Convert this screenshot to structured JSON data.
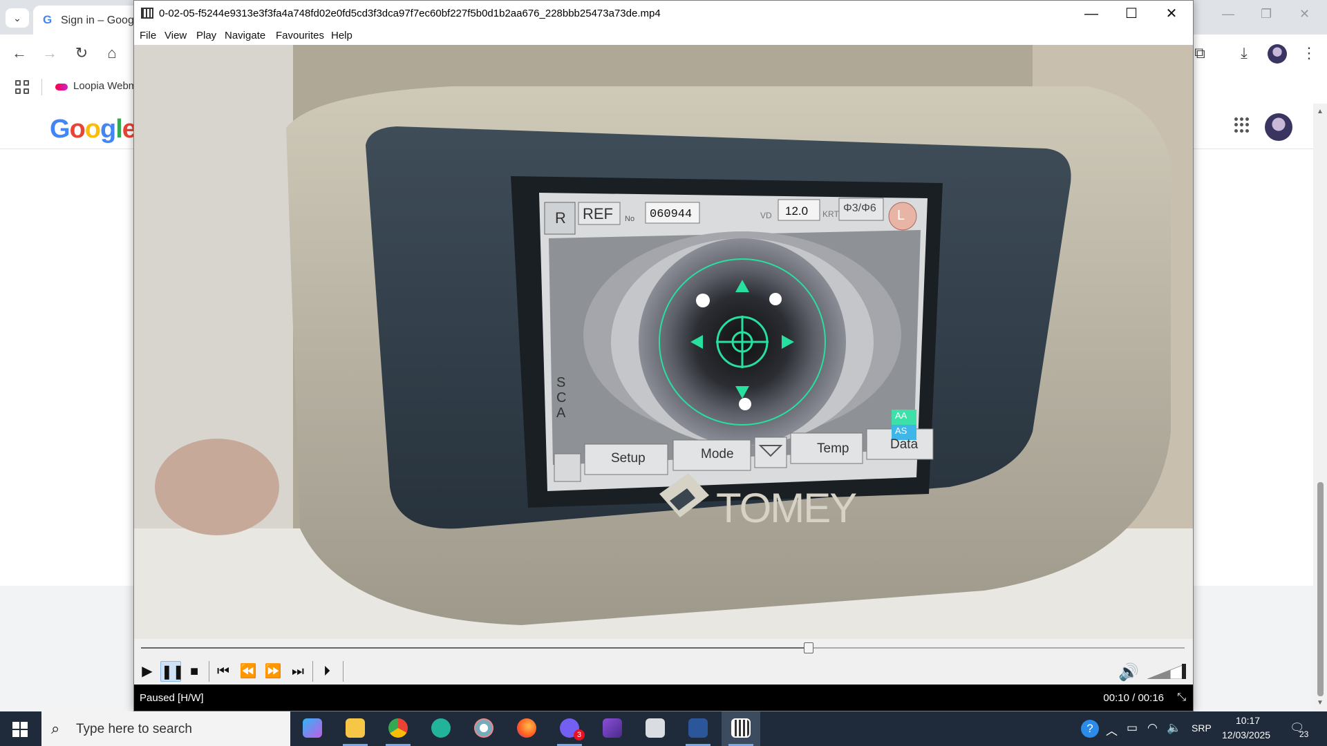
{
  "browser": {
    "tab_title": "Sign in – Google",
    "bookmark_label": "Loopia Webm",
    "logo": "Google"
  },
  "player": {
    "title": "0-02-05-f5244e9313e3f3fa4a748fd02e0fd5cd3f3dca97f7ec60bf227f5b0d1b2aa676_228bbb25473a73de.mp4",
    "menu": [
      "File",
      "View",
      "Play",
      "Navigate",
      "Favourites",
      "Help"
    ],
    "status": "Paused [H/W]",
    "time": "00:10 / 00:16",
    "progress_fraction": 0.64,
    "volume_fraction": 0.6
  },
  "device_screen": {
    "r_label": "R",
    "ref_label": "REF",
    "no_label": "No",
    "no_value": "060944",
    "vd_label": "VD",
    "vd_value": "12.0",
    "krt_label": "KRT",
    "phase": "Φ3/Φ6",
    "l_label": "L",
    "sca": [
      "S",
      "C",
      "A"
    ],
    "buttons": [
      "Setup",
      "Mode",
      "Temp",
      "Data"
    ],
    "aa_top": "AA",
    "aa_bottom": "AS",
    "brand": "TOMEY"
  },
  "taskbar": {
    "search_placeholder": "Type here to search",
    "badge_count": "3",
    "lang": "SRP",
    "time": "10:17",
    "date": "12/03/2025",
    "notif_count": "23"
  },
  "colors": {
    "overlay_green": "#27e0a0",
    "taskbar_bg": "#1f2a3a",
    "status_bg": "#000000"
  }
}
